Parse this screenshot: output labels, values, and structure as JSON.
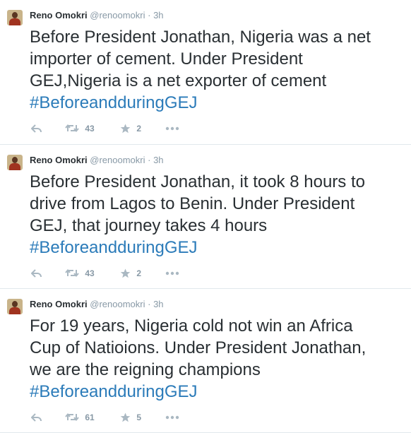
{
  "tweets": [
    {
      "fullname": "Reno Omokri",
      "username": "@renoomokri",
      "separator": "·",
      "time": "3h",
      "lines": [
        "Before President Jonathan, Nigeria was a net",
        "importer of cement. Under President",
        "GEJ,Nigeria is a net exporter of cement"
      ],
      "hashtag": "#BeforeandduringGEJ",
      "retweets": "43",
      "favorites": "2"
    },
    {
      "fullname": "Reno Omokri",
      "username": "@renoomokri",
      "separator": "·",
      "time": "3h",
      "lines": [
        "Before President Jonathan, it took 8 hours to",
        "drive from Lagos to Benin. Under President",
        "GEJ, that journey takes 4 hours"
      ],
      "hashtag": "#BeforeandduringGEJ",
      "retweets": "43",
      "favorites": "2"
    },
    {
      "fullname": "Reno Omokri",
      "username": "@renoomokri",
      "separator": "·",
      "time": "3h",
      "lines": [
        "For 19 years, Nigeria cold not win an Africa",
        "Cup of Natioions. Under President Jonathan,",
        "we are the reigning champions"
      ],
      "hashtag": "#BeforeandduringGEJ",
      "retweets": "61",
      "favorites": "5"
    }
  ],
  "icons": {
    "reply": "reply-icon",
    "retweet": "retweet-icon",
    "favorite": "star-icon",
    "more": "more-icon",
    "avatar": "avatar"
  },
  "colors": {
    "text": "#292f33",
    "muted": "#8899a6",
    "hashtag": "#2b7bb9",
    "divider": "#e1e8ed"
  }
}
